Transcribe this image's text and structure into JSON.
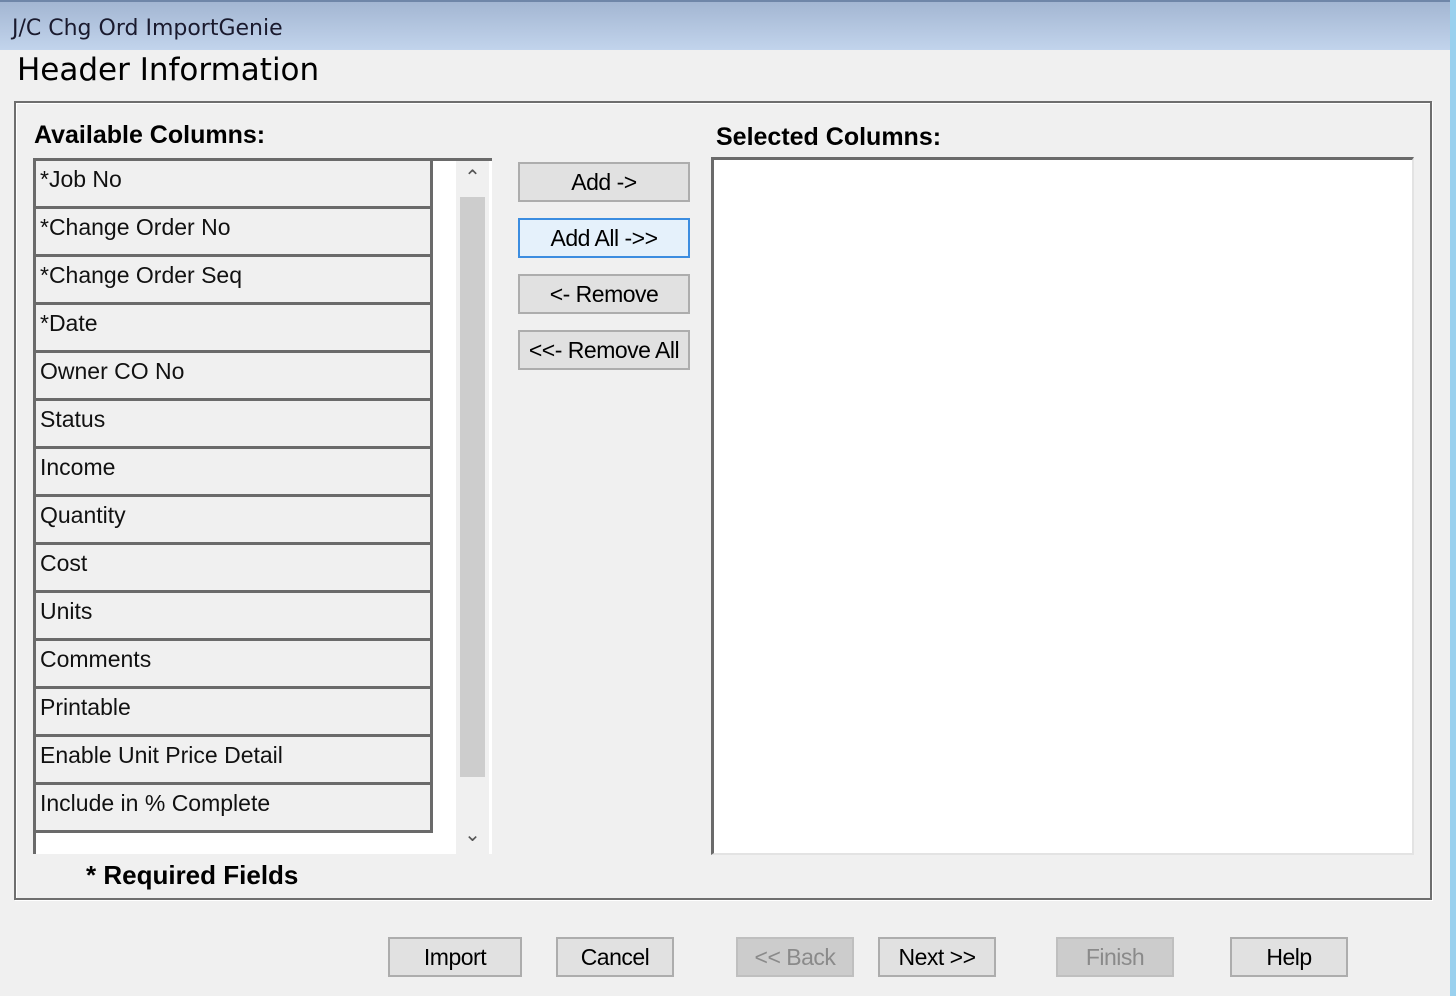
{
  "window": {
    "title": "J/C Chg Ord ImportGenie"
  },
  "page": {
    "title": "Header Information"
  },
  "available": {
    "label": "Available Columns:",
    "items": [
      "*Job No",
      "*Change Order No",
      "*Change Order Seq",
      "*Date",
      "Owner CO No",
      "Status",
      "Income",
      "Quantity",
      "Cost",
      "Units",
      "Comments",
      "Printable",
      "Enable Unit Price Detail",
      "Include in % Complete"
    ]
  },
  "selected": {
    "label": "Selected Columns:",
    "items": []
  },
  "transfer_buttons": {
    "add": "Add ->",
    "add_all": "Add All ->>",
    "remove": "<- Remove",
    "remove_all": "<<- Remove All"
  },
  "required_note": "* Required Fields",
  "footer_buttons": {
    "import": "Import",
    "cancel": "Cancel",
    "back": "<< Back",
    "next": "Next >>",
    "finish": "Finish",
    "help": "Help"
  },
  "scroll_icons": {
    "up": "chevron-up-icon",
    "down": "chevron-down-icon"
  }
}
